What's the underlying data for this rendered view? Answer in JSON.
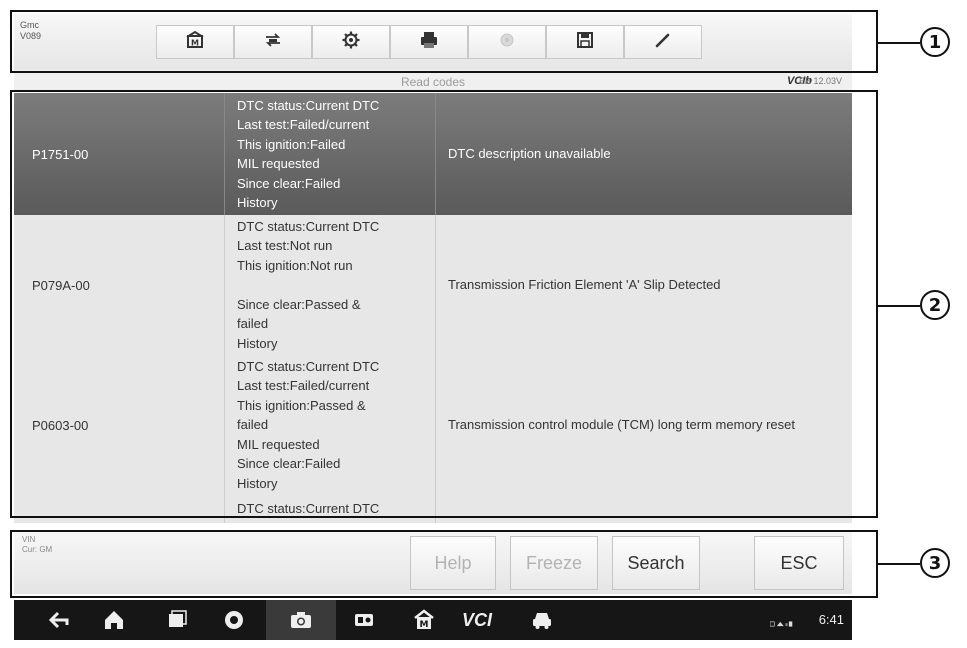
{
  "vehicle": {
    "make": "Gmc",
    "model": "V089"
  },
  "toolbar": {
    "buttons": [
      {
        "icon": "home-icon"
      },
      {
        "icon": "vehicle-swap-icon"
      },
      {
        "icon": "gear-icon"
      },
      {
        "icon": "printer-icon"
      },
      {
        "icon": "help-circle-icon"
      },
      {
        "icon": "save-icon"
      },
      {
        "icon": "pen-icon"
      }
    ]
  },
  "status": {
    "title": "Read codes",
    "vci": "VCIb",
    "battery": "EB 12.03V"
  },
  "dtc_rows": [
    {
      "code": "P1751-00",
      "status_lines": [
        "DTC status:Current DTC",
        "Last test:Failed/current",
        "This ignition:Failed",
        "MIL requested",
        "Since clear:Failed",
        "History"
      ],
      "description": "DTC description unavailable",
      "selected": true
    },
    {
      "code": "P079A-00",
      "status_lines": [
        "DTC status:Current DTC",
        "Last test:Not run",
        "This ignition:Not run",
        "",
        "Since clear:Passed &",
        "failed",
        "History"
      ],
      "description": "Transmission Friction Element 'A' Slip Detected",
      "selected": false
    },
    {
      "code": "P0603-00",
      "status_lines": [
        "DTC status:Current DTC",
        "Last test:Failed/current",
        "This ignition:Passed &",
        "failed",
        "MIL requested",
        "Since clear:Failed",
        "History"
      ],
      "description": "Transmission control module (TCM) long term memory reset",
      "selected": false
    },
    {
      "code": "",
      "status_lines": [
        "DTC status:Current DTC"
      ],
      "description": "",
      "selected": false
    }
  ],
  "bottom": {
    "vin_label": "VIN",
    "cur_label": "Cur: GM",
    "buttons": {
      "help": "Help",
      "freeze": "Freeze",
      "search": "Search",
      "esc": "ESC"
    }
  },
  "navbar": {
    "icons": [
      "back-icon",
      "home-icon",
      "recent-apps-icon",
      "browser-icon",
      "camera-icon",
      "dongle-icon",
      "maxisys-home-icon",
      "vci-icon",
      "car-icon"
    ],
    "vci_text": "VCI",
    "time": "6:41"
  },
  "callouts": [
    "1",
    "2",
    "3"
  ]
}
